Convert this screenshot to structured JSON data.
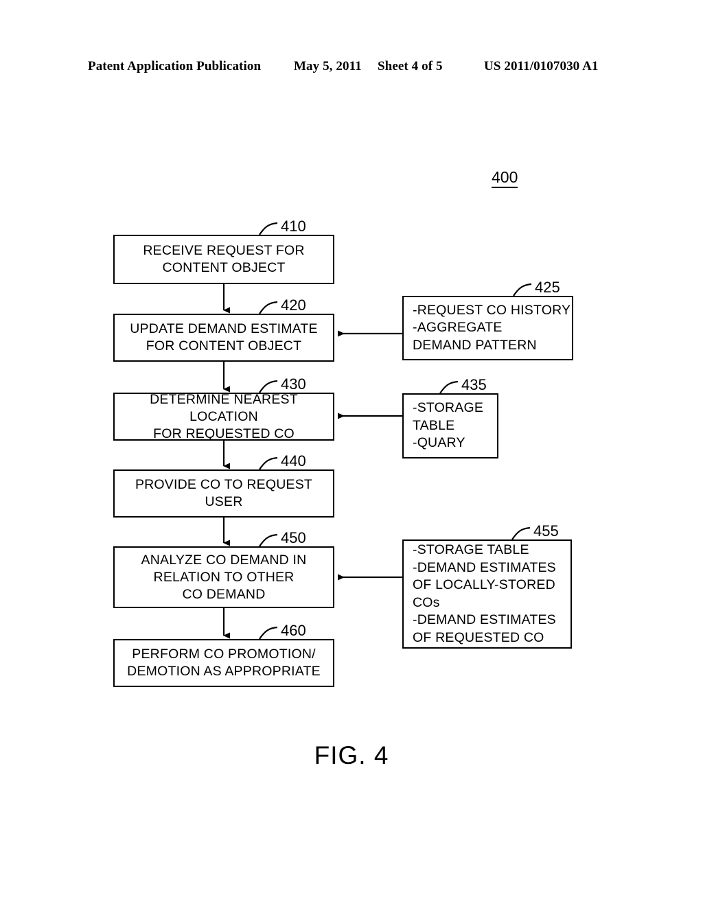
{
  "header": {
    "publication": "Patent Application Publication",
    "date": "May 5, 2011",
    "sheet": "Sheet 4 of 5",
    "patent_number": "US 2011/0107030 A1"
  },
  "figure": {
    "caption": "FIG. 4",
    "diagram_ref": "400"
  },
  "flow": {
    "steps": [
      {
        "ref": "410",
        "text": "RECEIVE REQUEST FOR\nCONTENT OBJECT"
      },
      {
        "ref": "420",
        "text": "UPDATE DEMAND ESTIMATE\nFOR CONTENT OBJECT"
      },
      {
        "ref": "430",
        "text": "DETERMINE NEAREST LOCATION\nFOR REQUESTED CO"
      },
      {
        "ref": "440",
        "text": "PROVIDE CO TO REQUEST\nUSER"
      },
      {
        "ref": "450",
        "text": "ANALYZE CO DEMAND IN\nRELATION TO OTHER\nCO DEMAND"
      },
      {
        "ref": "460",
        "text": "PERFORM CO PROMOTION/\nDEMOTION AS APPROPRIATE"
      }
    ],
    "annotations": [
      {
        "ref": "425",
        "text": "-REQUEST CO HISTORY\n-AGGREGATE\n DEMAND PATTERN",
        "target": "420"
      },
      {
        "ref": "435",
        "text": "-STORAGE\n TABLE\n-QUARY",
        "target": "430"
      },
      {
        "ref": "455",
        "text": "-STORAGE TABLE\n-DEMAND ESTIMATES\n OF LOCALLY-STORED\n COs\n-DEMAND ESTIMATES\n OF REQUESTED CO",
        "target": "450"
      }
    ]
  },
  "colors": {
    "ink": "#000000",
    "paper": "#ffffff"
  }
}
